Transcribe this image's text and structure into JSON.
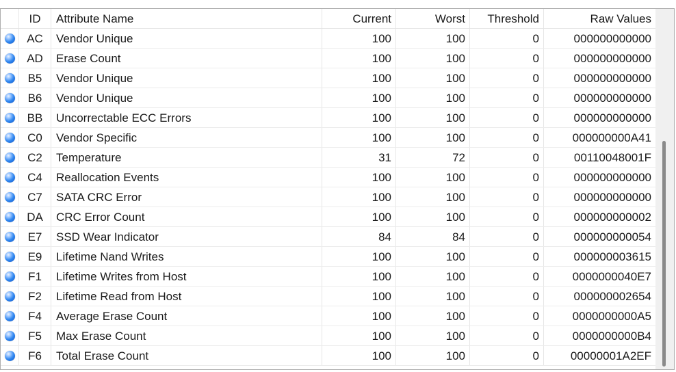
{
  "table": {
    "headers": {
      "id": "ID",
      "name": "Attribute Name",
      "current": "Current",
      "worst": "Worst",
      "threshold": "Threshold",
      "raw": "Raw Values"
    },
    "status_icon": "status-dot-blue-icon",
    "rows": [
      {
        "id": "AC",
        "name": "Vendor Unique",
        "current": "100",
        "worst": "100",
        "threshold": "0",
        "raw": "000000000000"
      },
      {
        "id": "AD",
        "name": "Erase Count",
        "current": "100",
        "worst": "100",
        "threshold": "0",
        "raw": "000000000000"
      },
      {
        "id": "B5",
        "name": "Vendor Unique",
        "current": "100",
        "worst": "100",
        "threshold": "0",
        "raw": "000000000000"
      },
      {
        "id": "B6",
        "name": "Vendor Unique",
        "current": "100",
        "worst": "100",
        "threshold": "0",
        "raw": "000000000000"
      },
      {
        "id": "BB",
        "name": "Uncorrectable ECC Errors",
        "current": "100",
        "worst": "100",
        "threshold": "0",
        "raw": "000000000000"
      },
      {
        "id": "C0",
        "name": "Vendor Specific",
        "current": "100",
        "worst": "100",
        "threshold": "0",
        "raw": "000000000A41"
      },
      {
        "id": "C2",
        "name": "Temperature",
        "current": "31",
        "worst": "72",
        "threshold": "0",
        "raw": "00110048001F"
      },
      {
        "id": "C4",
        "name": "Reallocation Events",
        "current": "100",
        "worst": "100",
        "threshold": "0",
        "raw": "000000000000"
      },
      {
        "id": "C7",
        "name": "SATA CRC Error",
        "current": "100",
        "worst": "100",
        "threshold": "0",
        "raw": "000000000000"
      },
      {
        "id": "DA",
        "name": "CRC Error Count",
        "current": "100",
        "worst": "100",
        "threshold": "0",
        "raw": "000000000002"
      },
      {
        "id": "E7",
        "name": "SSD Wear Indicator",
        "current": "84",
        "worst": "84",
        "threshold": "0",
        "raw": "000000000054"
      },
      {
        "id": "E9",
        "name": "Lifetime Nand Writes",
        "current": "100",
        "worst": "100",
        "threshold": "0",
        "raw": "000000003615"
      },
      {
        "id": "F1",
        "name": "Lifetime Writes from Host",
        "current": "100",
        "worst": "100",
        "threshold": "0",
        "raw": "0000000040E7"
      },
      {
        "id": "F2",
        "name": "Lifetime Read from Host",
        "current": "100",
        "worst": "100",
        "threshold": "0",
        "raw": "000000002654"
      },
      {
        "id": "F4",
        "name": "Average Erase Count",
        "current": "100",
        "worst": "100",
        "threshold": "0",
        "raw": "0000000000A5"
      },
      {
        "id": "F5",
        "name": "Max Erase Count",
        "current": "100",
        "worst": "100",
        "threshold": "0",
        "raw": "0000000000B4"
      },
      {
        "id": "F6",
        "name": "Total Erase Count",
        "current": "100",
        "worst": "100",
        "threshold": "0",
        "raw": "00000001A2EF"
      }
    ]
  },
  "colors": {
    "status_dot": "#2e86f0",
    "grid_line": "#ececec",
    "border": "#adadad"
  }
}
